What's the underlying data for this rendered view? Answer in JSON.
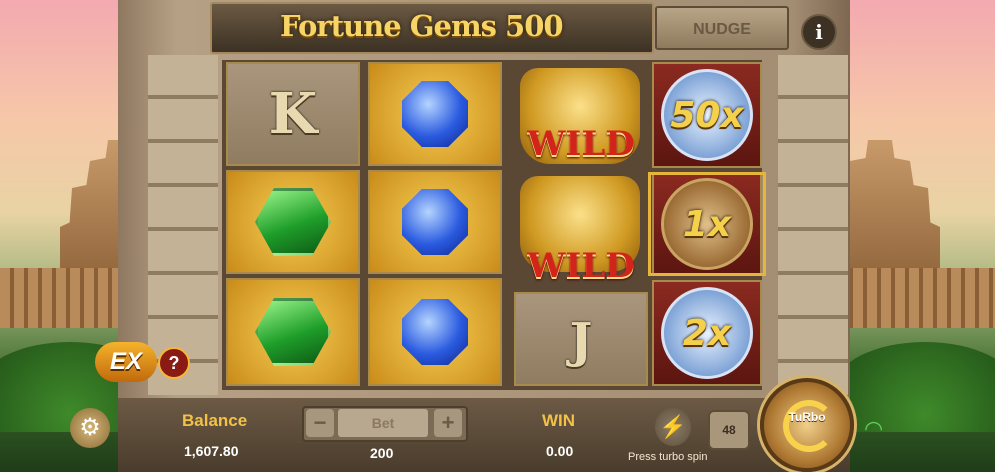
{
  "game": {
    "title": "Fortune Gems 500",
    "nudge_label": "NUDGE",
    "info_label": "i"
  },
  "reels": [
    [
      "K",
      "emerald",
      "emerald"
    ],
    [
      "sapphire",
      "sapphire",
      "sapphire"
    ],
    [
      "WILD",
      "WILD",
      "J"
    ],
    [
      "50x",
      "1x",
      "2x"
    ]
  ],
  "symbols": {
    "K": "K",
    "J": "J",
    "wild": "WILD",
    "m50": "50x",
    "m1": "1x",
    "m2": "2x"
  },
  "extra_bet": {
    "label": "EX",
    "help": "?"
  },
  "hud": {
    "balance_label": "Balance",
    "balance_value": "1,607.80",
    "bet_label": "Bet",
    "bet_value": "200",
    "bet_minus": "−",
    "bet_plus": "+",
    "win_label": "WIN",
    "win_value": "0.00",
    "auto_spin_count": "48",
    "turbo_hint": "Press turbo spin",
    "spin_label": "TuRbo"
  },
  "colors": {
    "gold_text": "#f2c246",
    "wild_red": "#d3241c",
    "highlight": "#e7b53a"
  },
  "icons": [
    "settings-gear-icon",
    "lightning-bolt-icon",
    "wifi-icon",
    "spin-arrow-icon",
    "info-icon"
  ]
}
